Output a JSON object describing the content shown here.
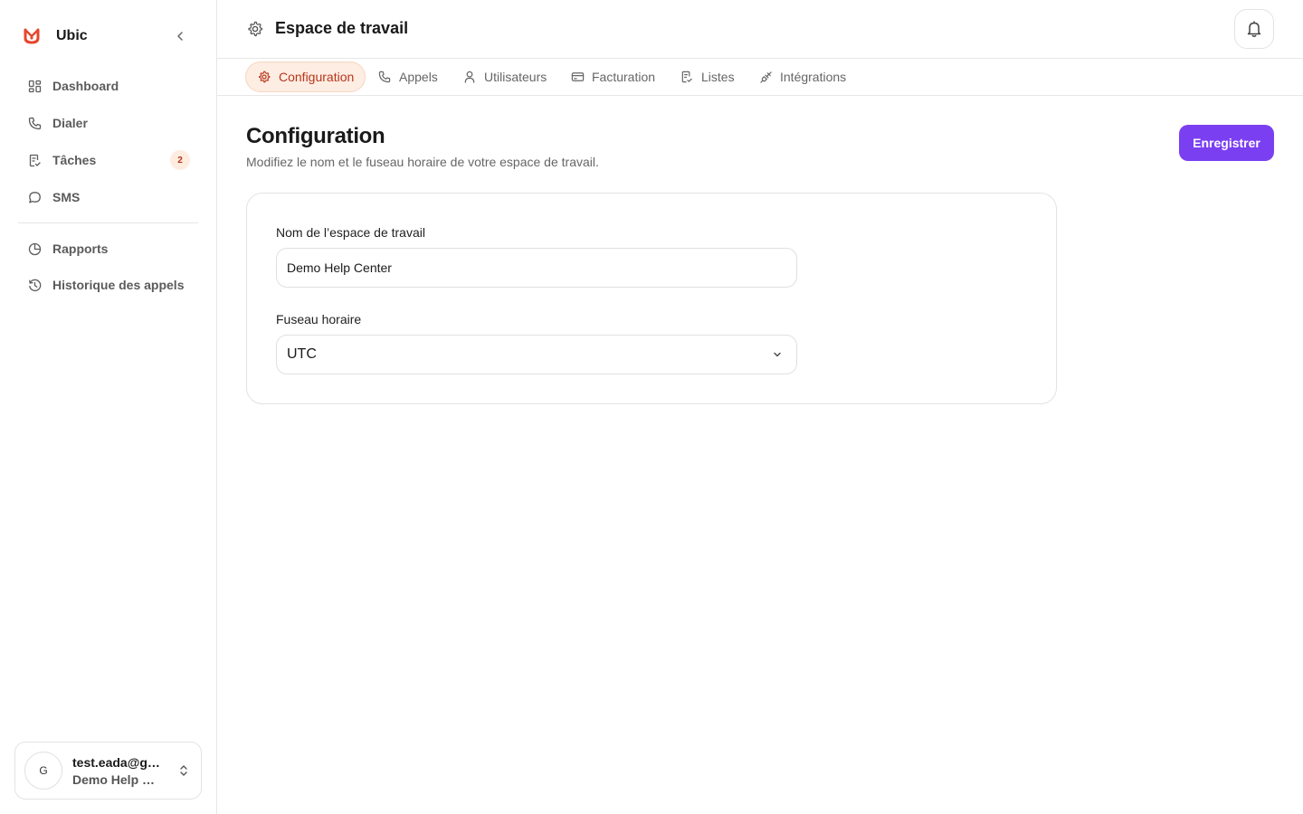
{
  "app": {
    "name": "Ubic",
    "accent_color": "#e8452c",
    "primary_color": "#7b3ff2"
  },
  "sidebar": {
    "nav": [
      {
        "label": "Dashboard",
        "icon": "grid-icon"
      },
      {
        "label": "Dialer",
        "icon": "phone-icon"
      },
      {
        "label": "Tâches",
        "icon": "task-icon",
        "badge": "2"
      },
      {
        "label": "SMS",
        "icon": "message-icon"
      }
    ],
    "nav_secondary": [
      {
        "label": "Rapports",
        "icon": "pie-chart-icon"
      },
      {
        "label": "Historique des appels",
        "icon": "history-icon"
      }
    ],
    "user": {
      "avatar_initial": "G",
      "email": "test.eada@g…",
      "workspace": "Demo Help …"
    }
  },
  "header": {
    "title": "Espace de travail"
  },
  "tabs": [
    {
      "label": "Configuration",
      "icon": "gear-icon",
      "active": true
    },
    {
      "label": "Appels",
      "icon": "phone-icon",
      "active": false
    },
    {
      "label": "Utilisateurs",
      "icon": "user-icon",
      "active": false
    },
    {
      "label": "Facturation",
      "icon": "credit-card-icon",
      "active": false
    },
    {
      "label": "Listes",
      "icon": "list-icon",
      "active": false
    },
    {
      "label": "Intégrations",
      "icon": "plug-icon",
      "active": false
    }
  ],
  "main": {
    "title": "Configuration",
    "subtitle": "Modifiez le nom et le fuseau horaire de votre espace de travail.",
    "save_label": "Enregistrer",
    "form": {
      "name_label": "Nom de l’espace de travail",
      "name_value": "Demo Help Center",
      "timezone_label": "Fuseau horaire",
      "timezone_value": "UTC"
    }
  }
}
